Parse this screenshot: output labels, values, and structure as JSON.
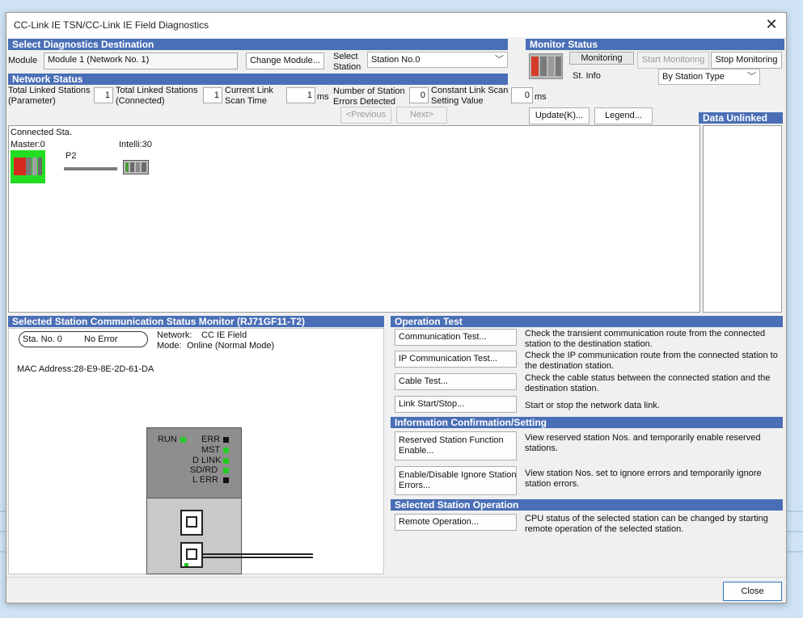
{
  "window": {
    "title": "CC-Link IE TSN/CC-Link IE Field Diagnostics"
  },
  "destination": {
    "header": "Select Diagnostics Destination",
    "module_label": "Module",
    "module_value": "Module 1 (Network No. 1)",
    "change_module_button": "Change Module...",
    "select_station_label_1": "Select",
    "select_station_label_2": "Station",
    "station_value": "Station No.0"
  },
  "monitor": {
    "header": "Monitor Status",
    "status": "Monitoring",
    "start_button": "Start Monitoring",
    "stop_button": "Stop Monitoring",
    "st_info_label": "St. Info",
    "st_info_value": "By Station Type"
  },
  "network_status": {
    "header": "Network Status",
    "total_param_1": "Total Linked Stations",
    "total_param_2": "(Parameter)",
    "total_param_value": "1",
    "total_conn_1": "Total Linked Stations",
    "total_conn_2": "(Connected)",
    "total_conn_value": "1",
    "scan_1": "Current Link",
    "scan_2": "Scan Time",
    "scan_value": "1",
    "scan_unit": "ms",
    "errors_1": "Number of Station",
    "errors_2": "Errors Detected",
    "errors_value": "0",
    "const_1": "Constant Link Scan",
    "const_2": "Setting Value",
    "const_value": "0",
    "const_unit": "ms",
    "prev_button": "<Previous",
    "next_button": "Next>",
    "update_button": "Update(K)...",
    "legend_button": "Legend..."
  },
  "data_unlinked": {
    "header": "Data Unlinked"
  },
  "map": {
    "connected_label": "Connected Sta.",
    "master_label": "Master:0",
    "port_label": "P2",
    "intelli_label": "Intelli:30"
  },
  "selected_station": {
    "header": "Selected Station Communication Status Monitor (RJ71GF11-T2)",
    "sta_no": "Sta. No. 0",
    "status": "No Error",
    "network_label": "Network:",
    "network_value": "CC IE Field",
    "mode_label": "Mode:",
    "mode_value": "Online (Normal Mode)",
    "mac": "MAC Address:28-E9-8E-2D-61-DA",
    "leds": {
      "run": "RUN",
      "err": "ERR",
      "mst": "MST",
      "dlink": "D LINK",
      "sdrd": "SD/RD",
      "lerr": "L ERR"
    }
  },
  "operation_test": {
    "header": "Operation Test",
    "items": [
      {
        "button": "Communication Test...",
        "desc": "Check the transient communication route from the connected station to the destination station."
      },
      {
        "button": "IP Communication Test...",
        "desc": "Check the IP communication route from the connected station to the destination station."
      },
      {
        "button": "Cable Test...",
        "desc": "Check the cable status between the connected station and the destination station."
      },
      {
        "button": "Link Start/Stop...",
        "desc": "Start or stop the network data link."
      }
    ]
  },
  "info_setting": {
    "header": "Information Confirmation/Setting",
    "items": [
      {
        "button_1": "Reserved Station Function",
        "button_2": "Enable...",
        "desc": "View reserved station Nos. and temporarily enable reserved stations."
      },
      {
        "button_1": "Enable/Disable Ignore Station",
        "button_2": "Errors...",
        "desc": "View station Nos. set to ignore errors and temporarily ignore station errors."
      }
    ]
  },
  "station_op": {
    "header": "Selected Station Operation",
    "button": "Remote Operation...",
    "desc": "CPU status of the selected station can be changed by starting remote operation of the selected station."
  },
  "footer": {
    "close_button": "Close"
  },
  "colors": {
    "header_blue": "#4a6fb6",
    "led_green": "#22cc22",
    "master_green": "#22dd22"
  }
}
